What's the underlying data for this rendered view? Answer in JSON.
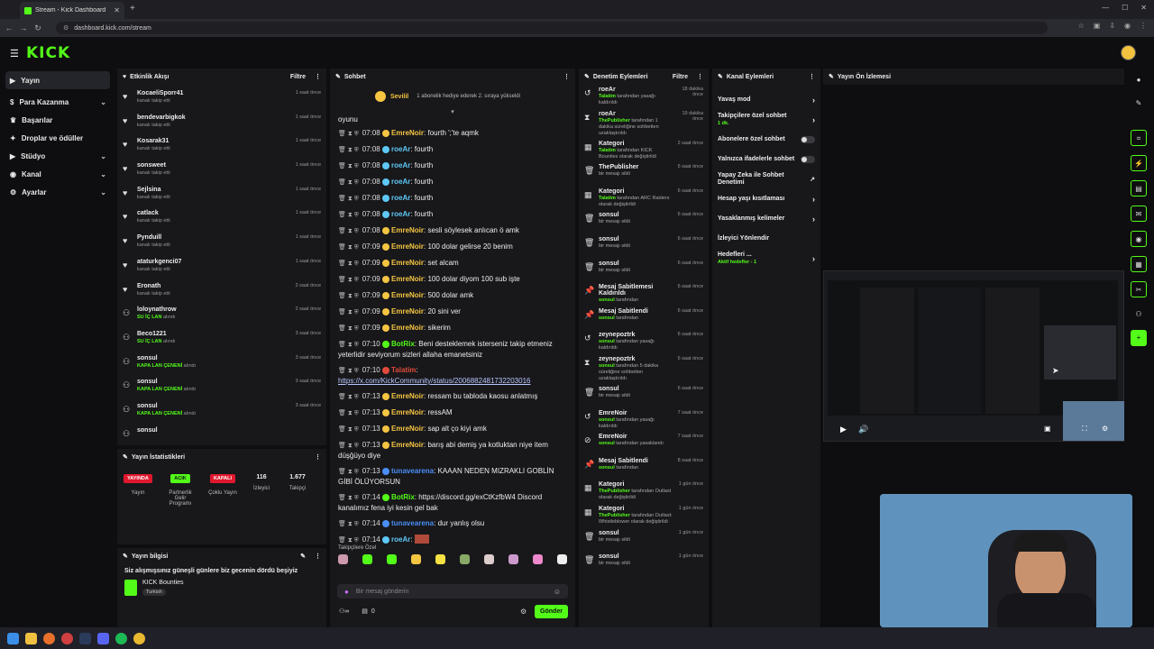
{
  "browser": {
    "tab_title": "Stream - Kick Dashboard",
    "url": "dashboard.kick.com/stream"
  },
  "app": {
    "brand": "KICK"
  },
  "sidebar": {
    "items": [
      {
        "label": "Yayın",
        "icon": "broadcast-icon",
        "active": true,
        "chevron": false
      },
      {
        "label": "Para Kazanma",
        "icon": "money-icon",
        "chevron": true
      },
      {
        "label": "Başarılar",
        "icon": "trophy-icon",
        "chevron": false
      },
      {
        "label": "Droplar ve ödüller",
        "icon": "gift-icon",
        "chevron": false
      },
      {
        "label": "Stüdyo",
        "icon": "studio-icon",
        "chevron": true
      },
      {
        "label": "Kanal",
        "icon": "person-icon",
        "chevron": true
      },
      {
        "label": "Ayarlar",
        "icon": "gear-icon",
        "chevron": true
      }
    ]
  },
  "activity": {
    "title": "Etkinlik Akışı",
    "filter": "Filtre",
    "events": [
      {
        "name": "KocaeliSporr41",
        "sub": "kanalı takip etti",
        "time": "1 saat önce",
        "icon": "heart"
      },
      {
        "name": "bendevarbigkok",
        "sub": "kanalı takip etti",
        "time": "1 saat önce",
        "icon": "heart"
      },
      {
        "name": "Kosarak31",
        "sub": "kanalı takip etti",
        "time": "1 saat önce",
        "icon": "heart"
      },
      {
        "name": "sonsweet",
        "sub": "kanalı takip etti",
        "time": "1 saat önce",
        "icon": "heart"
      },
      {
        "name": "Sejlsina",
        "sub": "kanalı takip etti",
        "time": "1 saat önce",
        "icon": "heart"
      },
      {
        "name": "catlack",
        "sub": "kanalı takip etti",
        "time": "1 saat önce",
        "icon": "heart"
      },
      {
        "name": "Pynduill",
        "sub": "kanalı takip etti",
        "time": "1 saat önce",
        "icon": "heart"
      },
      {
        "name": "ataturkgenci07",
        "sub": "kanalı takip etti",
        "time": "1 saat önce",
        "icon": "heart"
      },
      {
        "name": "Eronath",
        "sub": "kanalı takip etti",
        "time": "2 saat önce",
        "icon": "heart"
      },
      {
        "name": "loloynathrow",
        "subg": "SU İÇ LAN",
        "sub": "alındı",
        "time": "2 saat önce",
        "icon": "reward"
      },
      {
        "name": "Beco1221",
        "subg": "SU İÇ LAN",
        "sub": "alındı",
        "time": "3 saat önce",
        "icon": "reward"
      },
      {
        "name": "sonsul",
        "subg": "KAPA LAN ÇENENİ",
        "sub": "alındı",
        "time": "3 saat önce",
        "icon": "reward"
      },
      {
        "name": "sonsul",
        "subg": "KAPA LAN ÇENENİ",
        "sub": "alındı",
        "time": "3 saat önce",
        "icon": "reward"
      },
      {
        "name": "sonsul",
        "subg": "KAPA LAN ÇENENİ",
        "sub": "alındı",
        "time": "3 saat önce",
        "icon": "reward"
      },
      {
        "name": "sonsul",
        "subg": "",
        "sub": "",
        "time": "",
        "icon": "reward"
      }
    ]
  },
  "stats": {
    "title": "Yayın İstatistikleri",
    "badges": [
      {
        "text": "YAYINDA",
        "label": "Yayın",
        "color": "#e0182e"
      },
      {
        "text": "ACIK",
        "label": "Partnerlik Gelir Programı",
        "color": "#53fc18"
      },
      {
        "text": "KAPALI",
        "label": "Çoklu Yayın",
        "color": "#e0182e"
      }
    ],
    "numbers": [
      {
        "value": "116",
        "label": "İzleyici"
      },
      {
        "value": "1.677",
        "label": "Takipçi"
      }
    ]
  },
  "info": {
    "title": "Yayın bilgisi",
    "stream_title": "Siz alışmışsınız güneşli günlere biz gecenin dördü beşiyiz",
    "category": "KICK Bounties",
    "language": "Turkish"
  },
  "chat": {
    "title": "Sohbet",
    "pinned_user": "Sevilil",
    "pinned_text": "1 abonelik hediye ederek 2. sıraya yükseldi",
    "top_text": "oyunu",
    "messages": [
      {
        "time": "07:08",
        "user": "EmreNoir",
        "color": "#f5c542",
        "text": "fourth ';'te aqmk",
        "link": false
      },
      {
        "time": "07:08",
        "user": "roeAr",
        "color": "#5ec8f5",
        "text": "fourth",
        "link": false
      },
      {
        "time": "07:08",
        "user": "roeAr",
        "color": "#5ec8f5",
        "text": "fourth",
        "link": false
      },
      {
        "time": "07:08",
        "user": "roeAr",
        "color": "#5ec8f5",
        "text": "fourth",
        "link": false
      },
      {
        "time": "07:08",
        "user": "roeAr",
        "color": "#5ec8f5",
        "text": "fourth",
        "link": false
      },
      {
        "time": "07:08",
        "user": "roeAr",
        "color": "#5ec8f5",
        "text": "fourth",
        "link": false
      },
      {
        "time": "07:08",
        "user": "EmreNoir",
        "color": "#f5c542",
        "text": "sesli söylesek anlıcan ö amk",
        "link": false
      },
      {
        "time": "07:09",
        "user": "EmreNoir",
        "color": "#f5c542",
        "text": "100 dolar gelirse 20 benim",
        "link": false
      },
      {
        "time": "07:09",
        "user": "EmreNoir",
        "color": "#f5c542",
        "text": "set alcam",
        "link": false
      },
      {
        "time": "07:09",
        "user": "EmreNoir",
        "color": "#f5c542",
        "text": "100 dolar diyom 100 sub işte",
        "link": false
      },
      {
        "time": "07:09",
        "user": "EmreNoir",
        "color": "#f5c542",
        "text": "500 dolar amk",
        "link": false
      },
      {
        "time": "07:09",
        "user": "EmreNoir",
        "color": "#f5c542",
        "text": "20 sini ver",
        "link": false
      },
      {
        "time": "07:09",
        "user": "EmreNoir",
        "color": "#f5c542",
        "text": "sikerim",
        "link": false
      },
      {
        "time": "07:10",
        "user": "BotRix",
        "color": "#53fc18",
        "text": "Beni desteklemek isterseniz takip etmeniz yeterlidir seviyorum sizleri allaha emanetsiniz",
        "link": false
      },
      {
        "time": "07:10",
        "user": "Talatim",
        "color": "#e04a3a",
        "text": "https://x.com/KickCommunity/status/2006882481732203016",
        "link": true
      },
      {
        "time": "07:13",
        "user": "EmreNoir",
        "color": "#f5c542",
        "text": "ressam bu tabloda kaosu anlatmış",
        "link": false
      },
      {
        "time": "07:13",
        "user": "EmreNoir",
        "color": "#f5c542",
        "text": "ressAM",
        "link": false
      },
      {
        "time": "07:13",
        "user": "EmreNoir",
        "color": "#f5c542",
        "text": "sap alt ço kiyi amk",
        "link": false
      },
      {
        "time": "07:13",
        "user": "EmreNoir",
        "color": "#f5c542",
        "text": "barış abi demiş ya kotluktan niye item düşğüyo diye",
        "link": false
      },
      {
        "time": "07:13",
        "user": "tunavearena",
        "color": "#4a8ef5",
        "text": "KAAAN NEDEN MIZRAKLI GOBLİN GİBİ ÖLÜYORSUN",
        "link": false
      },
      {
        "time": "07:14",
        "user": "BotRix",
        "color": "#53fc18",
        "text": "https://discord.gg/exCtKzfbW4 Discord kanalımız fena iyi kesin gel bak",
        "link": false
      },
      {
        "time": "07:14",
        "user": "tunavearena",
        "color": "#4a8ef5",
        "text": "dur yanlış olsu",
        "link": false
      },
      {
        "time": "07:14",
        "user": "roeAr",
        "color": "#5ec8f5",
        "text": "",
        "link": false
      }
    ],
    "emote_label": "Takipçilere Özel",
    "placeholder": "Bir mesaj gönderin",
    "send": "Gönder",
    "count": "0"
  },
  "moderation": {
    "title": "Denetim Eylemleri",
    "filter": "Filtre",
    "events": [
      {
        "name": "roeAr",
        "subg": "Talatim",
        "sub": "tarafından yasağı kaldırıldı",
        "time": "18 dakika önce",
        "icon": "undo"
      },
      {
        "name": "roeAr",
        "subg": "ThePublisher",
        "sub": "tarafından 1 dakika süreliğine sohbetten uzaklaştırıldı",
        "time": "19 dakika önce",
        "icon": "hourglass"
      },
      {
        "name": "Kategori",
        "subg": "Talatim",
        "sub": "tarafından KICK Bounties olarak değiştirildi",
        "time": "2 saat önce",
        "icon": "calendar"
      },
      {
        "name": "ThePublisher",
        "subg": "",
        "sub": "bir mesajı sildi",
        "time": "5 saat önce",
        "icon": "trash"
      },
      {
        "name": "Kategori",
        "subg": "Talatim",
        "sub": "tarafından ARC Raiders olarak değiştirildi",
        "time": "6 saat önce",
        "icon": "calendar"
      },
      {
        "name": "sonsul",
        "subg": "",
        "sub": "bir mesajı sildi",
        "time": "6 saat önce",
        "icon": "trash"
      },
      {
        "name": "sonsul",
        "subg": "",
        "sub": "bir mesajı sildi",
        "time": "6 saat önce",
        "icon": "trash"
      },
      {
        "name": "sonsul",
        "subg": "",
        "sub": "bir mesajı sildi",
        "time": "6 saat önce",
        "icon": "trash"
      },
      {
        "name": "Mesaj Sabitlemesi Kaldırıldı",
        "subg": "sonsul",
        "sub": "tarafından",
        "time": "6 saat önce",
        "icon": "pin"
      },
      {
        "name": "Mesaj Sabitlendi",
        "subg": "sonsul",
        "sub": "tarafından",
        "time": "6 saat önce",
        "icon": "pin"
      },
      {
        "name": "zeynepoztrk",
        "subg": "sonsul",
        "sub": "tarafından yasağı kaldırıldı",
        "time": "6 saat önce",
        "icon": "undo"
      },
      {
        "name": "zeynepoztrk",
        "subg": "sonsul",
        "sub": "tarafından 5 dakika süreliğine sohbetten uzaklaştırıldı",
        "time": "6 saat önce",
        "icon": "hourglass"
      },
      {
        "name": "sonsul",
        "subg": "",
        "sub": "bir mesajı sildi",
        "time": "6 saat önce",
        "icon": "trash"
      },
      {
        "name": "EmreNoir",
        "subg": "sonsul",
        "sub": "tarafından yasağı kaldırıldı",
        "time": "7 saat önce",
        "icon": "undo"
      },
      {
        "name": "EmreNoir",
        "subg": "sonsul",
        "sub": "tarafından yasaklandı",
        "time": "7 saat önce",
        "icon": "ban"
      },
      {
        "name": "Mesaj Sabitlendi",
        "subg": "sonsul",
        "sub": "tarafından",
        "time": "8 saat önce",
        "icon": "pin"
      },
      {
        "name": "Kategori",
        "subg": "ThePublisher",
        "sub": "tarafından Outlast olarak değiştirildi",
        "time": "1 gün önce",
        "icon": "calendar"
      },
      {
        "name": "Kategori",
        "subg": "ThePublisher",
        "sub": "tarafından Outlast: Whistleblower olarak değiştirildi",
        "time": "1 gün önce",
        "icon": "calendar"
      },
      {
        "name": "sonsul",
        "subg": "",
        "sub": "bir mesajı sildi",
        "time": "1 gün önce",
        "icon": "trash"
      },
      {
        "name": "sonsul",
        "subg": "",
        "sub": "bir mesajı sildi",
        "time": "1 gün önce",
        "icon": "trash"
      }
    ]
  },
  "channel_actions": {
    "title": "Kanal Eylemleri",
    "items": [
      {
        "label": "Yavaş mod",
        "type": "arrow"
      },
      {
        "label": "Takipçilere özel sohbet",
        "sub": "1 dk.",
        "type": "arrow"
      },
      {
        "label": "Abonelere özel sohbet",
        "type": "toggle"
      },
      {
        "label": "Yalnızca ifadelerle sohbet",
        "type": "toggle"
      },
      {
        "label": "Yapay Zeka ile Sohbet Denetimi",
        "type": "external"
      },
      {
        "label": "Hesap yaşı kısıtlaması",
        "type": "arrow"
      },
      {
        "label": "Yasaklanmış kelimeler",
        "type": "arrow"
      },
      {
        "label": "İzleyici Yönlendir",
        "type": "none"
      },
      {
        "label": "Hedefleri ...",
        "sub": "Aktif hedefler - 1",
        "type": "arrow"
      }
    ]
  },
  "preview": {
    "title": "Yayın Ön İzlemesi"
  }
}
